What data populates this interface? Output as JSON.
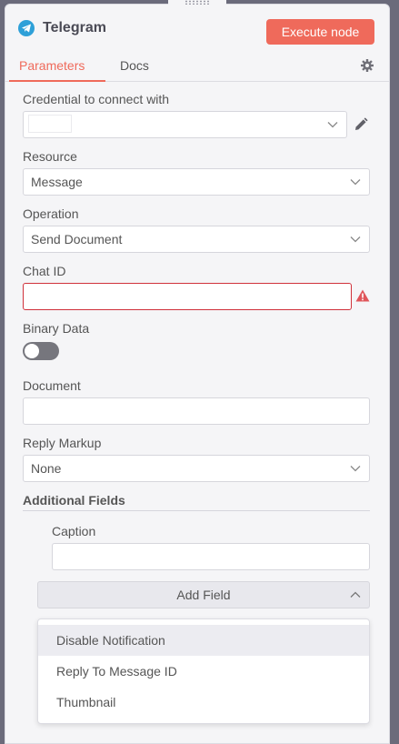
{
  "header": {
    "title": "Telegram",
    "execute_label": "Execute node"
  },
  "tabs": [
    {
      "label": "Parameters"
    },
    {
      "label": "Docs"
    }
  ],
  "fields": {
    "credential": {
      "label": "Credential to connect with",
      "value": ""
    },
    "resource": {
      "label": "Resource",
      "value": "Message"
    },
    "operation": {
      "label": "Operation",
      "value": "Send Document"
    },
    "chat_id": {
      "label": "Chat ID",
      "value": ""
    },
    "binary_data": {
      "label": "Binary Data",
      "enabled": false
    },
    "document": {
      "label": "Document",
      "value": ""
    },
    "reply_markup": {
      "label": "Reply Markup",
      "value": "None"
    }
  },
  "additional": {
    "title": "Additional Fields",
    "caption": {
      "label": "Caption",
      "value": ""
    },
    "add_field_label": "Add Field",
    "options": [
      {
        "label": "Disable Notification"
      },
      {
        "label": "Reply To Message ID"
      },
      {
        "label": "Thumbnail"
      }
    ]
  },
  "colors": {
    "accent": "#ef6a5b",
    "telegram": "#2ea0d8",
    "error": "#d0313b"
  }
}
